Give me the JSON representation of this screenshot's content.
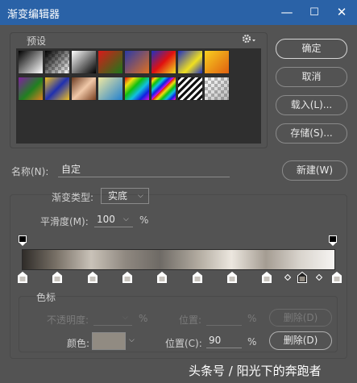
{
  "window": {
    "title": "渐变编辑器",
    "minimize": "—",
    "maximize": "☐",
    "close": "✕"
  },
  "presets": {
    "label": "预设",
    "gear_icon": "gear-icon"
  },
  "buttons": {
    "ok": "确定",
    "cancel": "取消",
    "load": "载入(L)...",
    "save": "存储(S)...",
    "new": "新建(W)"
  },
  "name": {
    "label": "名称(N):",
    "value": "自定"
  },
  "gradient_type": {
    "label": "渐变类型:",
    "value": "实底"
  },
  "smoothness": {
    "label": "平滑度(M):",
    "value": "100",
    "unit": "%"
  },
  "color_stops_section": {
    "title": "色标",
    "opacity_label": "不透明度:",
    "opacity_unit": "%",
    "location_label_dim": "位置:",
    "location_unit_dim": "%",
    "delete_dim": "删除(D)",
    "color_label": "颜色:",
    "location_label": "位置(C):",
    "location_value": "90",
    "location_unit": "%",
    "delete": "删除(D)",
    "color_value": "#918b82"
  },
  "gradient": {
    "colors": [
      "#2f2c29",
      "#7a7268",
      "#c9c2b8",
      "#8f8880",
      "#6e6a65",
      "#b0a99e",
      "#ece7df",
      "#a49c92",
      "#d9d4cd",
      "#f6f4f2"
    ],
    "opacity_stops": 2,
    "color_stops": 10
  },
  "watermark": "头条号 / 阳光下的奔跑者"
}
